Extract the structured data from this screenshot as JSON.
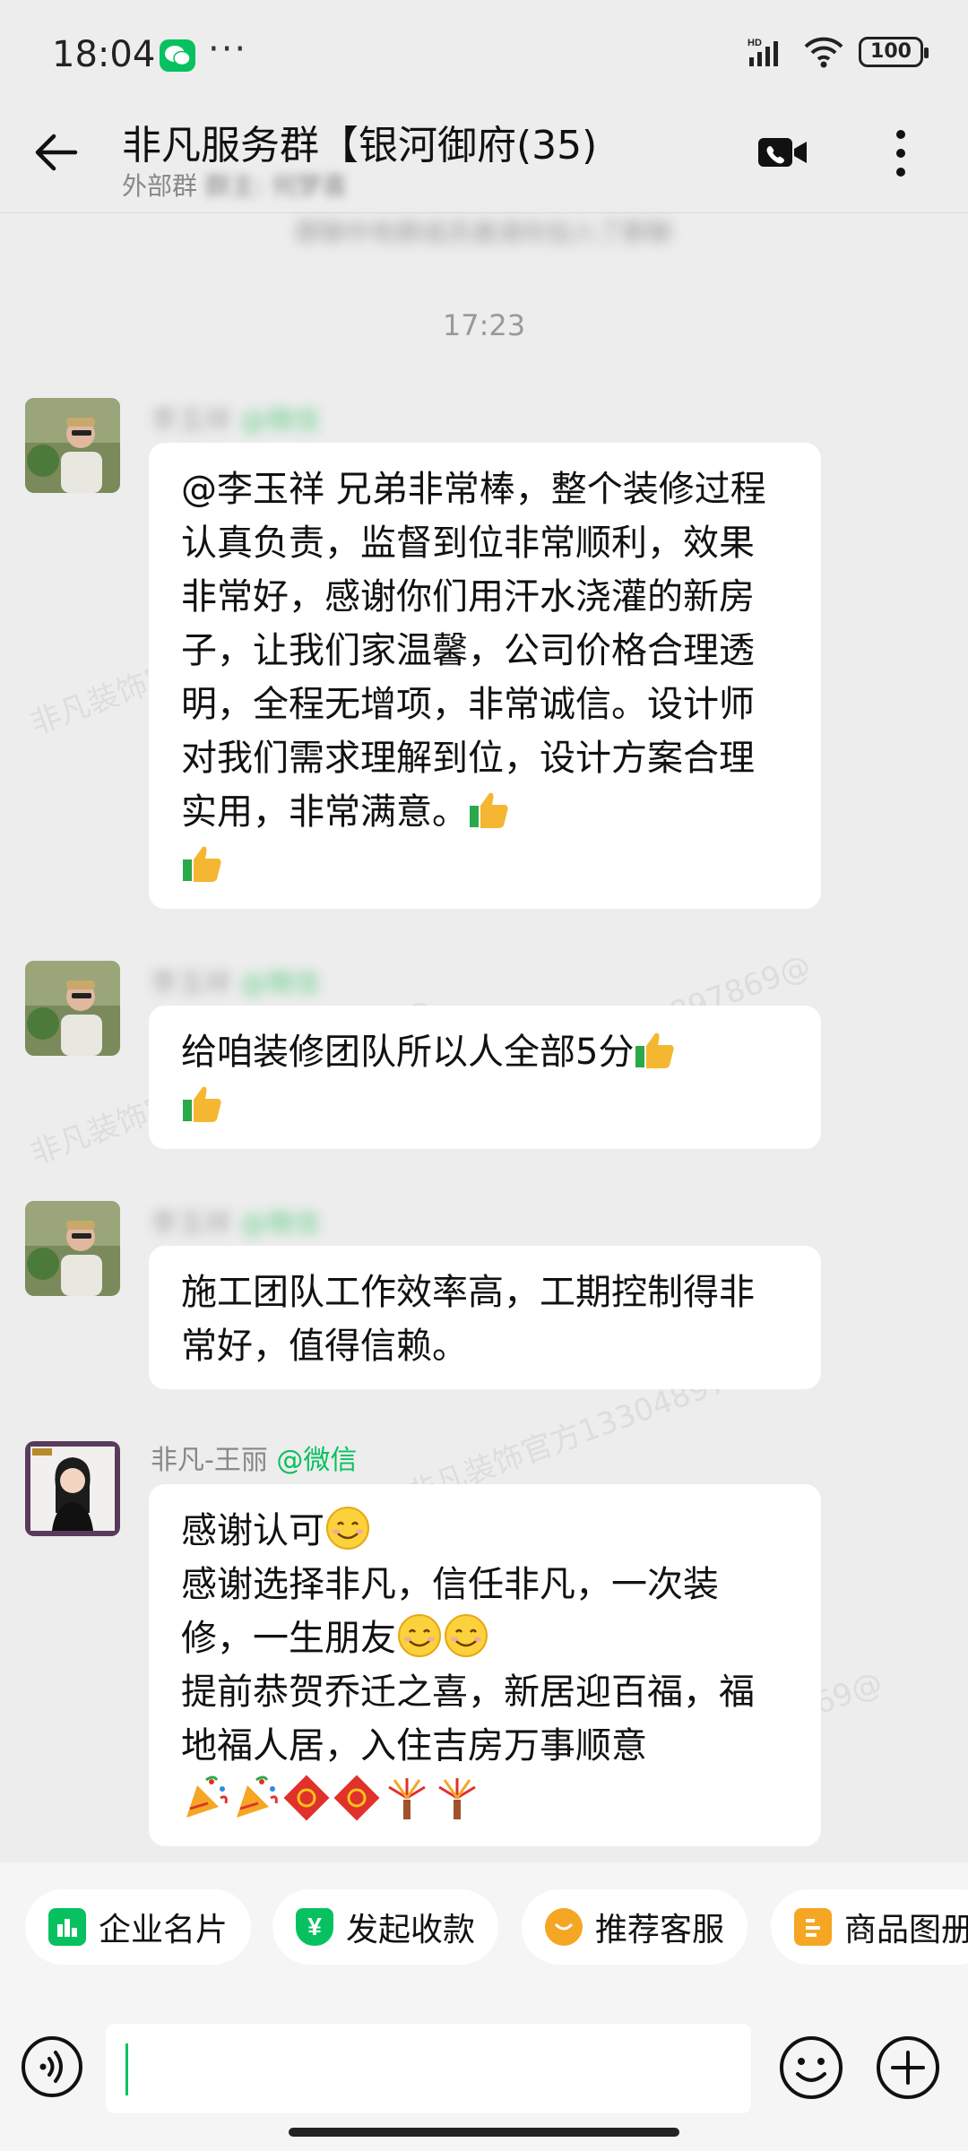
{
  "status_bar": {
    "time": "18:04",
    "more": "···",
    "network": "HD",
    "battery": "100"
  },
  "header": {
    "title": "非凡服务群【银河御府(35)",
    "subtitle_prefix": "外部群",
    "subtitle_owner": "群主: 何梦喜"
  },
  "system_notice": "群聊中有群成员邀请你加入了群聊",
  "timestamp": "17:23",
  "messages": [
    {
      "sender_blur": "李玉祥",
      "source_blur": "@微信",
      "lines": [
        "@李玉祥 兄弟非常棒，整个装修过程认真负责，监督到位非常顺利，效果非常好，感谢你们用汗水浇灌的新房子，让我们家温馨，公司价格合理透明，全程无增项，非常诚信。设计师对我们需求理解到位，设计方案合理实用，非常满意。"
      ]
    },
    {
      "sender_blur": "李玉祥",
      "source_blur": "@微信",
      "lines": [
        "给咱装修团队所以人全部5分"
      ]
    },
    {
      "sender_blur": "李玉祥",
      "source_blur": "@微信",
      "lines": [
        "施工团队工作效率高，工期控制得非常好，值得信赖。"
      ]
    },
    {
      "sender_name": "非凡-王丽",
      "source": "@微信",
      "lines": [
        "感谢认可",
        "感谢选择非凡，信任非凡，一次装修，一生朋友",
        "提前恭贺乔迁之喜，新居迎百福，福地福人居，入住吉房万事顺意"
      ]
    }
  ],
  "watermark": "非凡装饰官方13304897869@",
  "quick_actions": [
    {
      "label": "企业名片",
      "icon": "business-card-icon",
      "color": "#07c160"
    },
    {
      "label": "发起收款",
      "icon": "payment-icon",
      "color": "#07c160"
    },
    {
      "label": "推荐客服",
      "icon": "chat-bubble-icon",
      "color": "#f5a623"
    },
    {
      "label": "商品图册",
      "icon": "catalog-icon",
      "color": "#f5a623"
    }
  ],
  "input": {
    "placeholder": ""
  },
  "colors": {
    "accent": "#07c160",
    "background": "#ededed",
    "bubble": "#ffffff"
  }
}
